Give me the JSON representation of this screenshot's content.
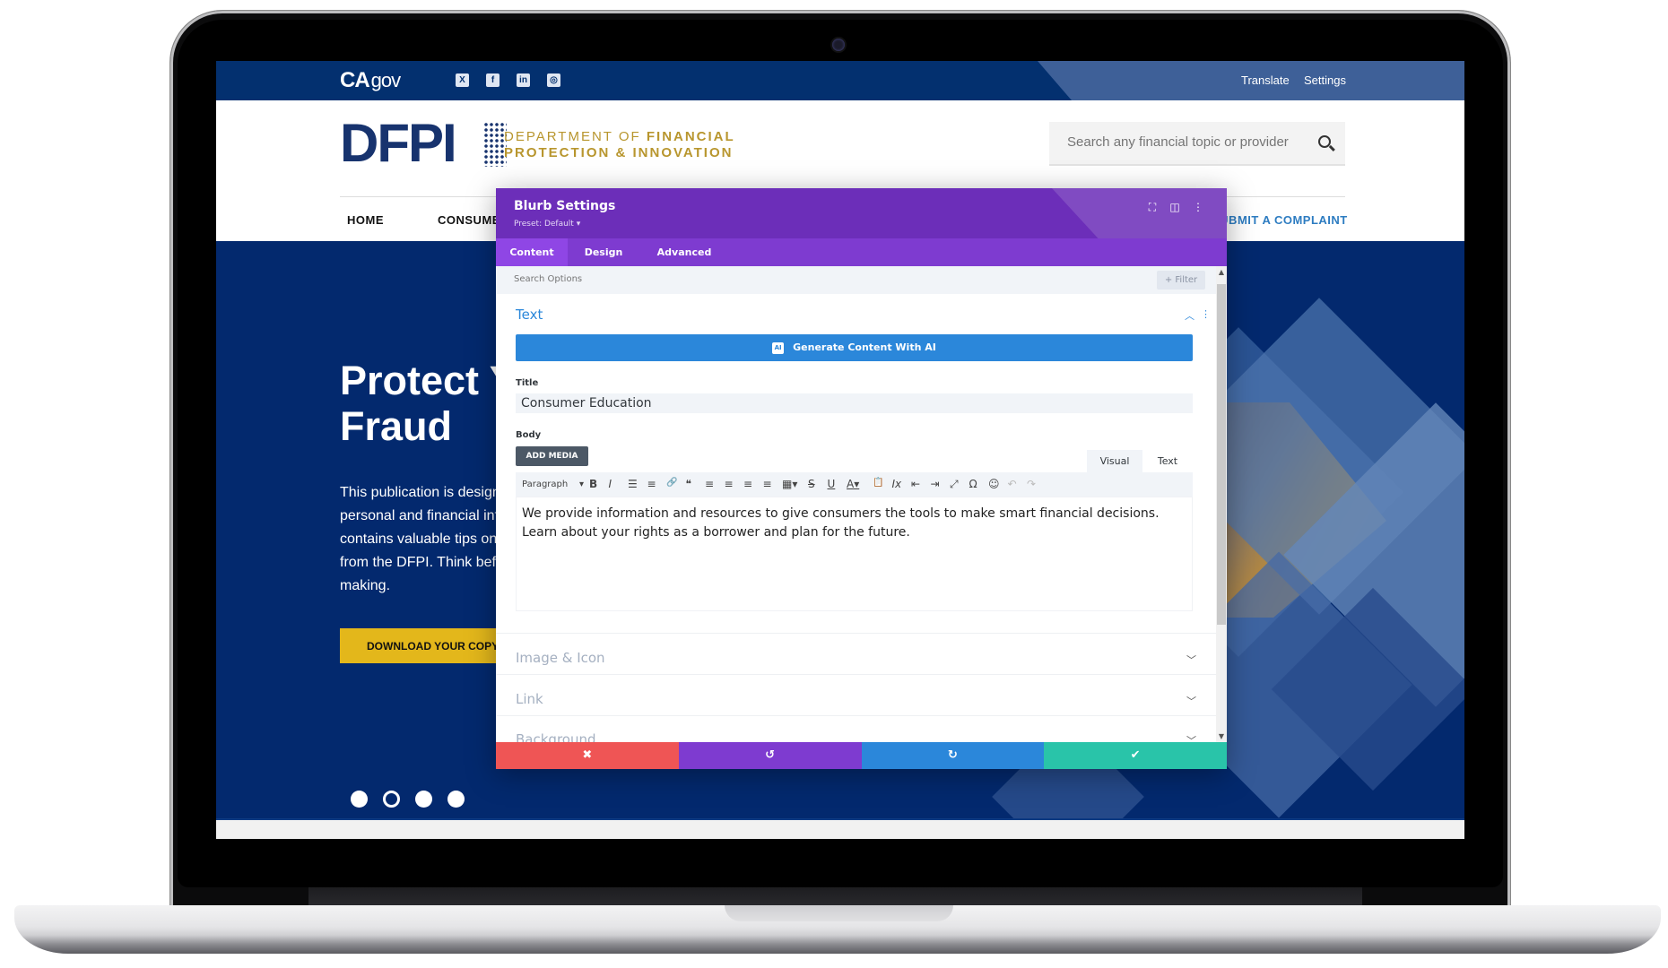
{
  "site": {
    "topbar": {
      "logo": {
        "main": "CA",
        "suffix": "gov"
      },
      "social": [
        {
          "icon": "x-twitter-icon",
          "glyph": "X"
        },
        {
          "icon": "facebook-icon",
          "glyph": "f"
        },
        {
          "icon": "linkedin-icon",
          "glyph": "in"
        },
        {
          "icon": "instagram-icon",
          "glyph": "◎"
        }
      ],
      "links": [
        "Translate",
        "Settings"
      ]
    },
    "header": {
      "logo_mark": "DFPI",
      "logo_line1_a": "DEPARTMENT OF ",
      "logo_line1_b": "FINANCIAL",
      "logo_line2_a": "PROTECTION & ",
      "logo_line2_b": "INNOVATION",
      "search_placeholder": "Search any financial topic or provider"
    },
    "nav": {
      "items": [
        "HOME",
        "CONSUMER",
        "SUBMIT A COMPLAINT"
      ]
    },
    "hero": {
      "headline_line1": "Protect Y",
      "headline_line2": "Fraud",
      "body": "This publication is designed to safeguard personal and financial information. It contains valuable tips on how to get help from the DFPI. Think before decision-making.",
      "button": "DOWNLOAD YOUR COPY TODAY",
      "carousel": {
        "total": 4,
        "active_index": 1
      }
    }
  },
  "modal": {
    "title": "Blurb Settings",
    "preset": "Preset: Default ▾",
    "header_icons": [
      "fullscreen-icon",
      "split-view-icon",
      "more-options-icon"
    ],
    "tabs": [
      {
        "label": "Content",
        "active": true
      },
      {
        "label": "Design",
        "active": false
      },
      {
        "label": "Advanced",
        "active": false
      }
    ],
    "search_placeholder": "Search Options",
    "filter_label": "+ Filter",
    "sections": {
      "text": {
        "title": "Text",
        "ai_button": "Generate Content With AI",
        "ai_badge": "AI",
        "title_label": "Title",
        "title_value": "Consumer Education",
        "body_label": "Body",
        "add_media": "ADD MEDIA",
        "editor_tabs": [
          {
            "label": "Visual",
            "active": true
          },
          {
            "label": "Text",
            "active": false
          }
        ],
        "format_select": "Paragraph",
        "toolbar": [
          {
            "name": "bold",
            "glyph": "B"
          },
          {
            "name": "italic",
            "glyph": "I"
          },
          {
            "name": "bullet-list",
            "glyph": "☰"
          },
          {
            "name": "numbered-list",
            "glyph": "≡"
          },
          {
            "name": "link",
            "glyph": "🔗"
          },
          {
            "name": "blockquote",
            "glyph": "❝"
          },
          {
            "name": "align-left",
            "glyph": "≡"
          },
          {
            "name": "align-center",
            "glyph": "≡"
          },
          {
            "name": "align-right",
            "glyph": "≡"
          },
          {
            "name": "justify",
            "glyph": "≡"
          },
          {
            "name": "table",
            "glyph": "▦▾"
          },
          {
            "name": "strikethrough",
            "glyph": "S"
          },
          {
            "name": "underline",
            "glyph": "U"
          },
          {
            "name": "text-color",
            "glyph": "A▾"
          },
          {
            "name": "paste-text",
            "glyph": "📋"
          },
          {
            "name": "clear-format",
            "glyph": "Ix"
          },
          {
            "name": "outdent",
            "glyph": "⇤"
          },
          {
            "name": "indent",
            "glyph": "⇥"
          },
          {
            "name": "fullscreen",
            "glyph": "⤢"
          },
          {
            "name": "special-char",
            "glyph": "Ω"
          },
          {
            "name": "emoji",
            "glyph": "☺"
          },
          {
            "name": "undo",
            "glyph": "↶"
          },
          {
            "name": "redo",
            "glyph": "↷"
          }
        ],
        "body_value": "We provide information and resources to give consumers the tools to make smart financial decisions. Learn about your rights as a borrower and plan for the future."
      },
      "collapsed": [
        "Image & Icon",
        "Link",
        "Background"
      ]
    },
    "footer": [
      {
        "name": "discard",
        "glyph": "✖",
        "color": "#ef5555"
      },
      {
        "name": "undo",
        "glyph": "↺",
        "color": "#7e3bd0"
      },
      {
        "name": "redo",
        "glyph": "↻",
        "color": "#2b87da"
      },
      {
        "name": "save",
        "glyph": "✔",
        "color": "#29c4a9"
      }
    ]
  }
}
